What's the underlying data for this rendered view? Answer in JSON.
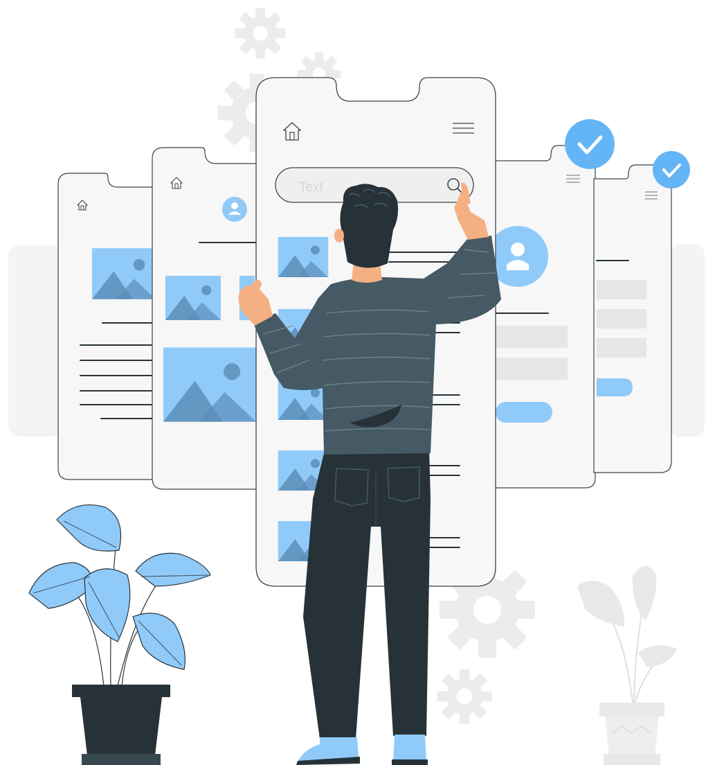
{
  "illustration": {
    "search_placeholder": "Text",
    "accent_color": "#90caf9",
    "dark_color": "#263238",
    "sweater_color": "#455a64",
    "screen_color": "#f6f6f6",
    "outline_color": "#3a4449",
    "icons": [
      "home-icon",
      "menu-icon",
      "search-icon",
      "user-icon",
      "check-icon",
      "image-placeholder-icon",
      "gear-icon",
      "plant-icon"
    ]
  }
}
